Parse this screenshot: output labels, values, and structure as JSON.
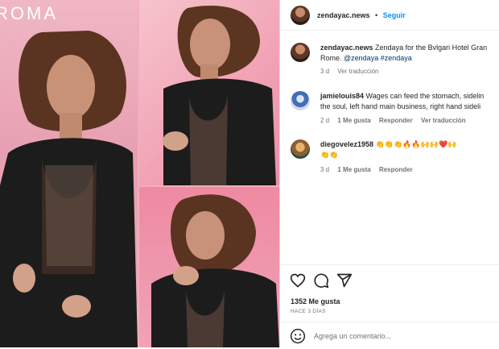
{
  "photo": {
    "brand_text": "ROMA"
  },
  "post": {
    "author": "zendayac.news",
    "separator": "•",
    "follow_label": "Seguir",
    "caption_author": "zendayac.news",
    "caption_text": "Zendaya for the Bvlgari Hotel Gran",
    "caption_line2": "Rome.",
    "hashtags": "@zendaya #zendaya",
    "caption_time": "3 d",
    "caption_translate": "Ver traducción",
    "likes": "1352 Me gusta",
    "time_ago": "HACE 3 DÍAS",
    "comment_placeholder": "Agrega un comentario..."
  },
  "comments": [
    {
      "user": "jamielouis84",
      "line1": "Wages can feed the stomach, sidelin",
      "line2": "the soul, left hand main business, right hand sideli",
      "time": "2 d",
      "likes": "1 Me gusta",
      "reply": "Responder",
      "translate": "Ver traducción"
    },
    {
      "user": "diegovelez1958",
      "line1": "👏👏👏🔥🔥🙌🙌❤️🙌",
      "line2": "👏👏",
      "time": "3 d",
      "likes": "1 Me gusta",
      "reply": "Responder"
    }
  ]
}
